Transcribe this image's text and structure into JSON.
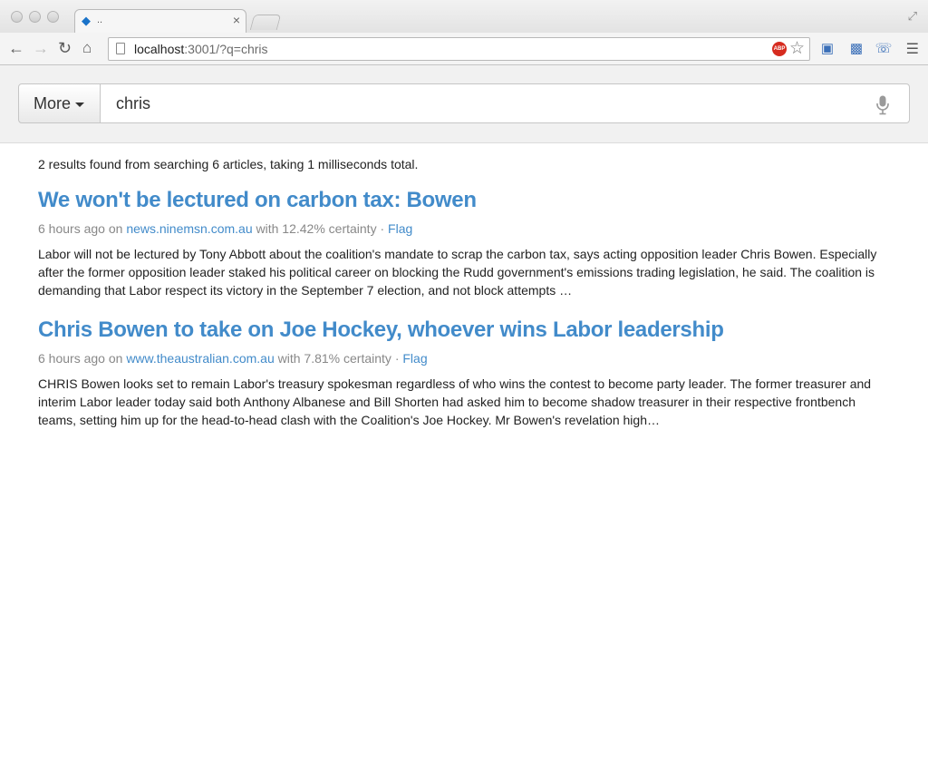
{
  "browser": {
    "tab_title": "..",
    "url_host": "localhost",
    "url_path": ":3001/?q=chris",
    "abp_label": "ABP"
  },
  "search": {
    "more_label": "More",
    "query": "chris"
  },
  "results": {
    "summary": "2 results found from searching 6 articles, taking 1 milliseconds total.",
    "items": [
      {
        "title": "We won't be lectured on carbon tax: Bowen",
        "age": "6 hours ago",
        "on": "on",
        "source": "news.ninemsn.com.au",
        "certainty": "with 12.42% certainty",
        "separator": "·",
        "flag": "Flag",
        "snippet": "Labor will not be lectured by Tony Abbott about the coalition's mandate to scrap the carbon tax, says acting opposition leader Chris Bowen. Especially after the former opposition leader staked his political career on blocking the Rudd government's emissions trading legislation, he said. The coalition is demanding that Labor respect its victory in the September 7 election, and not block attempts …"
      },
      {
        "title": "Chris Bowen to take on Joe Hockey, whoever wins Labor leadership",
        "age": "6 hours ago",
        "on": "on",
        "source": "www.theaustralian.com.au",
        "certainty": "with 7.81% certainty",
        "separator": "·",
        "flag": "Flag",
        "snippet": "CHRIS Bowen looks set to remain Labor's treasury spokesman regardless of who wins the contest to become party leader. The former treasurer and interim Labor leader today said both Anthony Albanese and Bill Shorten had asked him to become shadow treasurer in their respective frontbench teams, setting him up for the head-to-head clash with the Coalition's Joe Hockey. Mr Bowen's revelation high…"
      }
    ]
  },
  "colors": {
    "link": "#428bca",
    "meta": "#888888"
  }
}
